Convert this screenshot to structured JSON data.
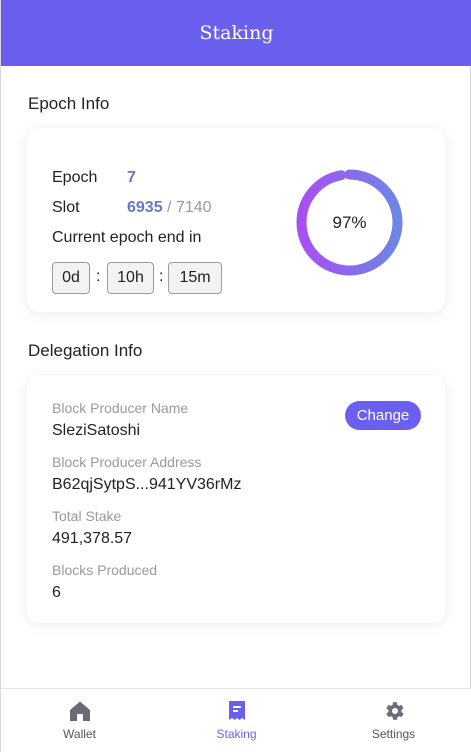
{
  "header": {
    "title": "Staking"
  },
  "epoch_info": {
    "section_title": "Epoch Info",
    "epoch_label": "Epoch",
    "epoch_value": "7",
    "slot_label": "Slot",
    "slot_current": "6935",
    "slot_total": "/ 7140",
    "end_label": "Current epoch end in",
    "days": "0d",
    "hours": "10h",
    "minutes": "15m",
    "separator": ":",
    "progress_percent": 97,
    "progress_label": "97%"
  },
  "delegation_info": {
    "section_title": "Delegation Info",
    "change_label": "Change",
    "producer_name_label": "Block Producer Name",
    "producer_name": "SleziSatoshi",
    "producer_address_label": "Block Producer Address",
    "producer_address": "B62qjSytpS...941YV36rMz",
    "total_stake_label": "Total Stake",
    "total_stake": "491,378.57",
    "blocks_label": "Blocks Produced",
    "blocks": "6"
  },
  "nav": {
    "items": [
      {
        "label": "Wallet",
        "icon": "home-icon"
      },
      {
        "label": "Staking",
        "icon": "staking-icon"
      },
      {
        "label": "Settings",
        "icon": "gear-icon"
      }
    ],
    "active_index": 1
  },
  "colors": {
    "accent": "#6b5ff0",
    "value_blue": "#6878c8",
    "ring_gradient_start": "#a84ff2",
    "ring_gradient_end": "#6c86e6"
  }
}
